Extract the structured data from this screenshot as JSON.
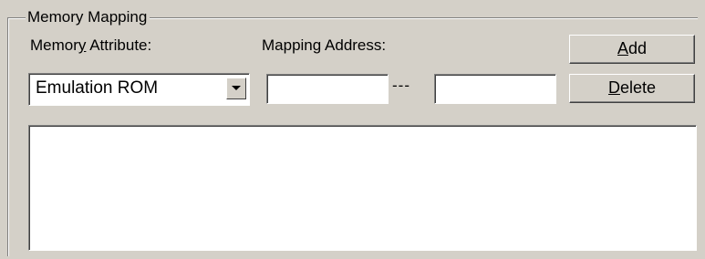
{
  "group": {
    "title": "Memory Mapping"
  },
  "memory_attribute": {
    "label_before": "Memor",
    "label_mnemonic": "y",
    "label_after": " Attribute:",
    "selected": "Emulation ROM"
  },
  "mapping_address": {
    "label_before": "Mappin",
    "label_mnemonic": "g",
    "label_after": " Address:",
    "start_value": "",
    "end_value": "",
    "separator": "---"
  },
  "buttons": {
    "add": {
      "mnemonic": "A",
      "rest": "dd"
    },
    "delete": {
      "mnemonic": "D",
      "rest": "elete"
    }
  },
  "mapping_list": {
    "items": []
  }
}
